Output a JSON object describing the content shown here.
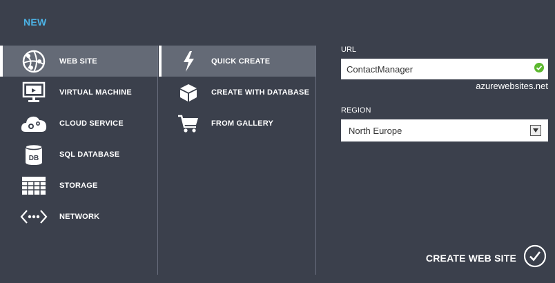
{
  "header": {
    "title": "NEW"
  },
  "categories": [
    {
      "label": "WEB SITE",
      "icon": "web-site-icon",
      "selected": true
    },
    {
      "label": "VIRTUAL MACHINE",
      "icon": "virtual-machine-icon",
      "selected": false
    },
    {
      "label": "CLOUD SERVICE",
      "icon": "cloud-service-icon",
      "selected": false
    },
    {
      "label": "SQL DATABASE",
      "icon": "sql-database-icon",
      "selected": false
    },
    {
      "label": "STORAGE",
      "icon": "storage-icon",
      "selected": false
    },
    {
      "label": "NETWORK",
      "icon": "network-icon",
      "selected": false
    }
  ],
  "options": [
    {
      "label": "QUICK CREATE",
      "icon": "lightning-icon",
      "selected": true
    },
    {
      "label": "CREATE WITH DATABASE",
      "icon": "package-icon",
      "selected": false
    },
    {
      "label": "FROM GALLERY",
      "icon": "cart-icon",
      "selected": false
    }
  ],
  "form": {
    "url_label": "URL",
    "url_value": "ContactManager",
    "url_suffix": "azurewebsites.net",
    "region_label": "REGION",
    "region_value": "North Europe"
  },
  "action": {
    "create_label": "CREATE WEB SITE"
  },
  "colors": {
    "background": "#3b404c",
    "accent": "#4cb3e6",
    "selected": "#646a76",
    "valid": "#5cb82e"
  }
}
